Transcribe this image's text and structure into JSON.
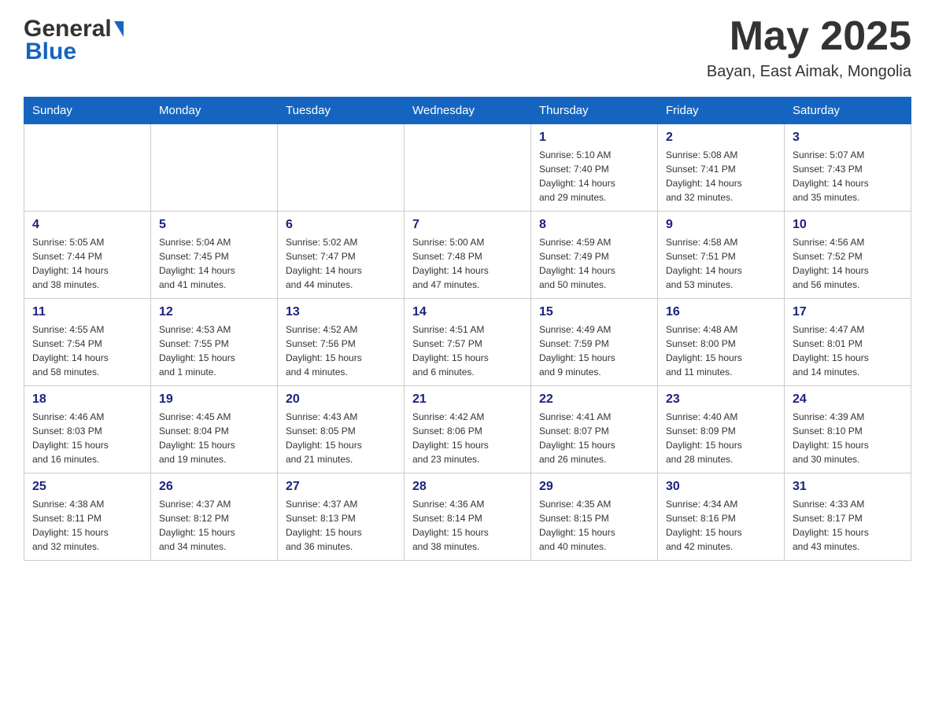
{
  "header": {
    "logo_general": "General",
    "logo_blue": "Blue",
    "month_year": "May 2025",
    "location": "Bayan, East Aimak, Mongolia"
  },
  "days_of_week": [
    "Sunday",
    "Monday",
    "Tuesday",
    "Wednesday",
    "Thursday",
    "Friday",
    "Saturday"
  ],
  "weeks": [
    {
      "days": [
        {
          "number": "",
          "info": ""
        },
        {
          "number": "",
          "info": ""
        },
        {
          "number": "",
          "info": ""
        },
        {
          "number": "",
          "info": ""
        },
        {
          "number": "1",
          "info": "Sunrise: 5:10 AM\nSunset: 7:40 PM\nDaylight: 14 hours\nand 29 minutes."
        },
        {
          "number": "2",
          "info": "Sunrise: 5:08 AM\nSunset: 7:41 PM\nDaylight: 14 hours\nand 32 minutes."
        },
        {
          "number": "3",
          "info": "Sunrise: 5:07 AM\nSunset: 7:43 PM\nDaylight: 14 hours\nand 35 minutes."
        }
      ]
    },
    {
      "days": [
        {
          "number": "4",
          "info": "Sunrise: 5:05 AM\nSunset: 7:44 PM\nDaylight: 14 hours\nand 38 minutes."
        },
        {
          "number": "5",
          "info": "Sunrise: 5:04 AM\nSunset: 7:45 PM\nDaylight: 14 hours\nand 41 minutes."
        },
        {
          "number": "6",
          "info": "Sunrise: 5:02 AM\nSunset: 7:47 PM\nDaylight: 14 hours\nand 44 minutes."
        },
        {
          "number": "7",
          "info": "Sunrise: 5:00 AM\nSunset: 7:48 PM\nDaylight: 14 hours\nand 47 minutes."
        },
        {
          "number": "8",
          "info": "Sunrise: 4:59 AM\nSunset: 7:49 PM\nDaylight: 14 hours\nand 50 minutes."
        },
        {
          "number": "9",
          "info": "Sunrise: 4:58 AM\nSunset: 7:51 PM\nDaylight: 14 hours\nand 53 minutes."
        },
        {
          "number": "10",
          "info": "Sunrise: 4:56 AM\nSunset: 7:52 PM\nDaylight: 14 hours\nand 56 minutes."
        }
      ]
    },
    {
      "days": [
        {
          "number": "11",
          "info": "Sunrise: 4:55 AM\nSunset: 7:54 PM\nDaylight: 14 hours\nand 58 minutes."
        },
        {
          "number": "12",
          "info": "Sunrise: 4:53 AM\nSunset: 7:55 PM\nDaylight: 15 hours\nand 1 minute."
        },
        {
          "number": "13",
          "info": "Sunrise: 4:52 AM\nSunset: 7:56 PM\nDaylight: 15 hours\nand 4 minutes."
        },
        {
          "number": "14",
          "info": "Sunrise: 4:51 AM\nSunset: 7:57 PM\nDaylight: 15 hours\nand 6 minutes."
        },
        {
          "number": "15",
          "info": "Sunrise: 4:49 AM\nSunset: 7:59 PM\nDaylight: 15 hours\nand 9 minutes."
        },
        {
          "number": "16",
          "info": "Sunrise: 4:48 AM\nSunset: 8:00 PM\nDaylight: 15 hours\nand 11 minutes."
        },
        {
          "number": "17",
          "info": "Sunrise: 4:47 AM\nSunset: 8:01 PM\nDaylight: 15 hours\nand 14 minutes."
        }
      ]
    },
    {
      "days": [
        {
          "number": "18",
          "info": "Sunrise: 4:46 AM\nSunset: 8:03 PM\nDaylight: 15 hours\nand 16 minutes."
        },
        {
          "number": "19",
          "info": "Sunrise: 4:45 AM\nSunset: 8:04 PM\nDaylight: 15 hours\nand 19 minutes."
        },
        {
          "number": "20",
          "info": "Sunrise: 4:43 AM\nSunset: 8:05 PM\nDaylight: 15 hours\nand 21 minutes."
        },
        {
          "number": "21",
          "info": "Sunrise: 4:42 AM\nSunset: 8:06 PM\nDaylight: 15 hours\nand 23 minutes."
        },
        {
          "number": "22",
          "info": "Sunrise: 4:41 AM\nSunset: 8:07 PM\nDaylight: 15 hours\nand 26 minutes."
        },
        {
          "number": "23",
          "info": "Sunrise: 4:40 AM\nSunset: 8:09 PM\nDaylight: 15 hours\nand 28 minutes."
        },
        {
          "number": "24",
          "info": "Sunrise: 4:39 AM\nSunset: 8:10 PM\nDaylight: 15 hours\nand 30 minutes."
        }
      ]
    },
    {
      "days": [
        {
          "number": "25",
          "info": "Sunrise: 4:38 AM\nSunset: 8:11 PM\nDaylight: 15 hours\nand 32 minutes."
        },
        {
          "number": "26",
          "info": "Sunrise: 4:37 AM\nSunset: 8:12 PM\nDaylight: 15 hours\nand 34 minutes."
        },
        {
          "number": "27",
          "info": "Sunrise: 4:37 AM\nSunset: 8:13 PM\nDaylight: 15 hours\nand 36 minutes."
        },
        {
          "number": "28",
          "info": "Sunrise: 4:36 AM\nSunset: 8:14 PM\nDaylight: 15 hours\nand 38 minutes."
        },
        {
          "number": "29",
          "info": "Sunrise: 4:35 AM\nSunset: 8:15 PM\nDaylight: 15 hours\nand 40 minutes."
        },
        {
          "number": "30",
          "info": "Sunrise: 4:34 AM\nSunset: 8:16 PM\nDaylight: 15 hours\nand 42 minutes."
        },
        {
          "number": "31",
          "info": "Sunrise: 4:33 AM\nSunset: 8:17 PM\nDaylight: 15 hours\nand 43 minutes."
        }
      ]
    }
  ]
}
